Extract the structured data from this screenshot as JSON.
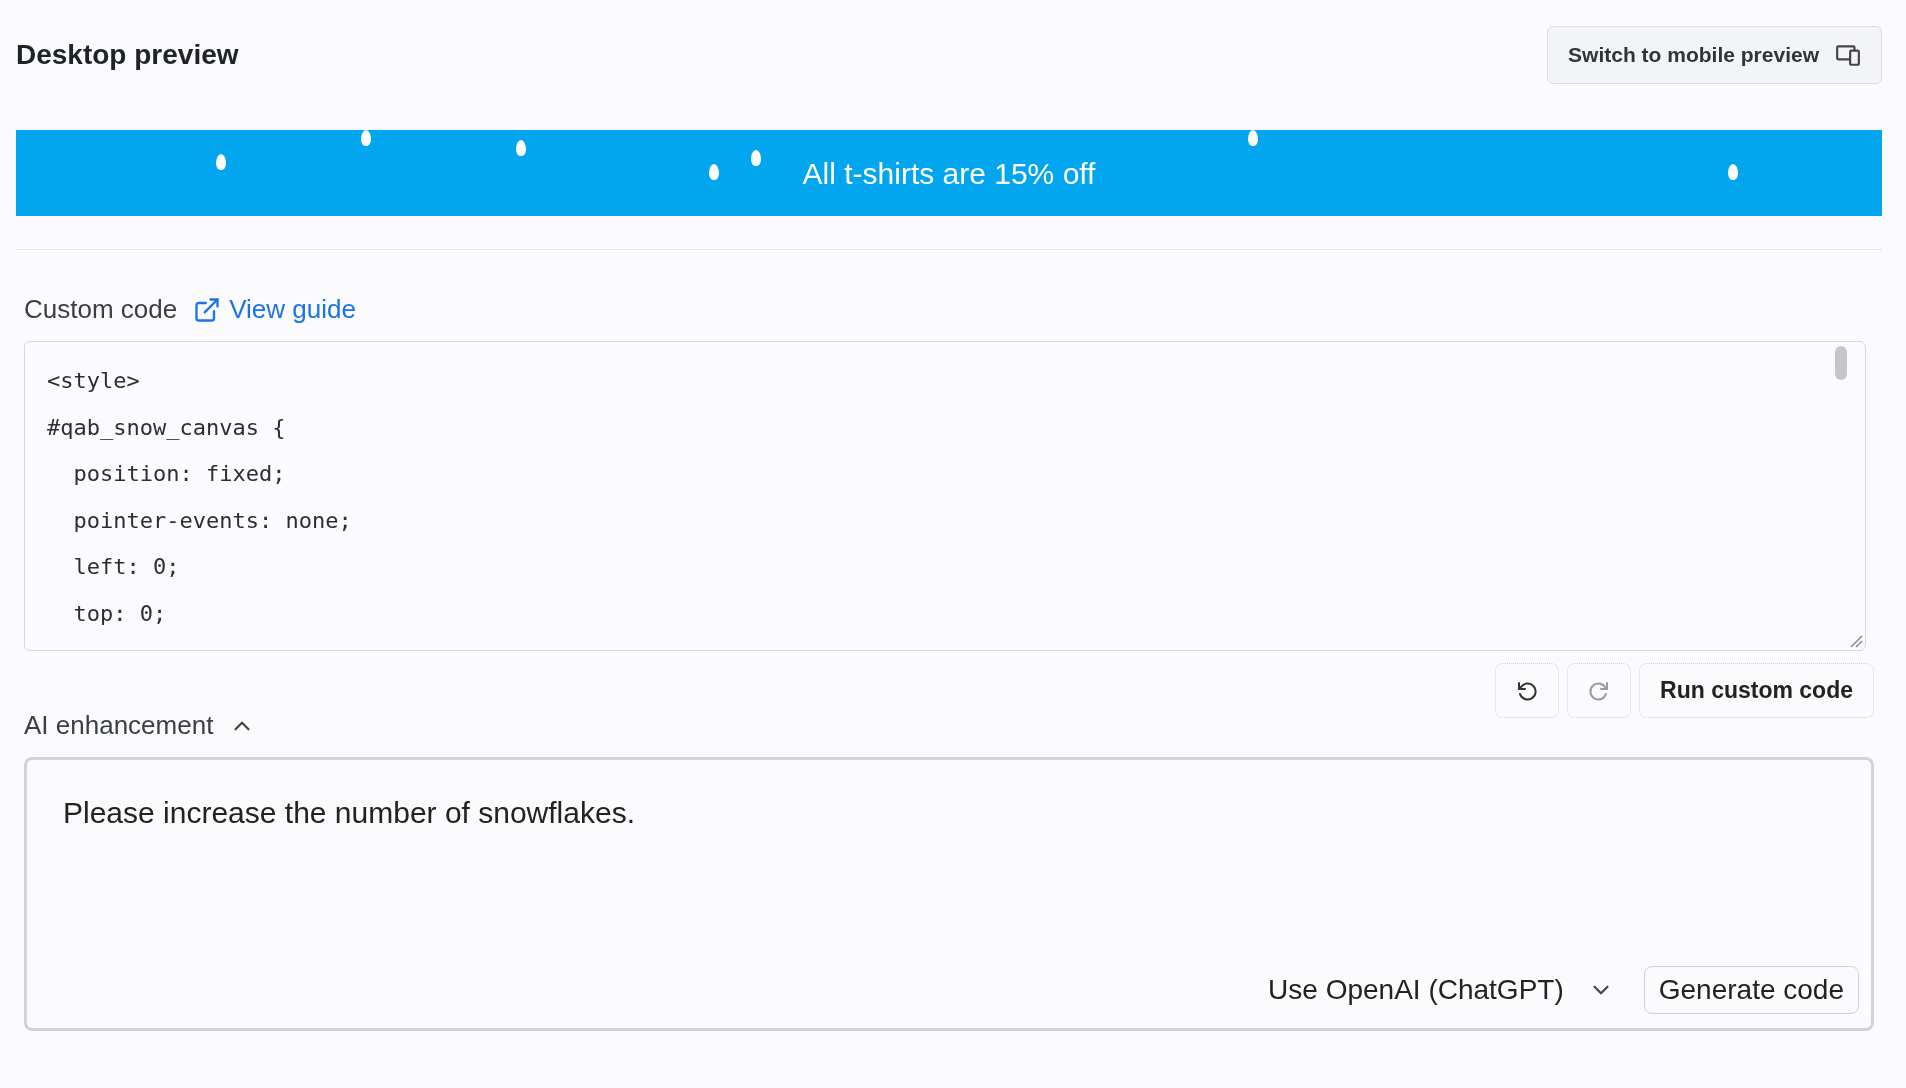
{
  "header": {
    "title": "Desktop preview",
    "switch_button": "Switch to mobile preview"
  },
  "banner": {
    "text": "All t-shirts are 15% off"
  },
  "custom_code": {
    "label": "Custom code",
    "link": "View guide",
    "lines": [
      "<style>",
      "#qab_snow_canvas {",
      "  position: fixed;",
      "  pointer-events: none;",
      "  left: 0;",
      "  top: 0;"
    ]
  },
  "history_buttons": [
    {
      "kind": "undo",
      "disabled": false
    },
    {
      "kind": "redo",
      "disabled": true
    }
  ],
  "run_button": "Run custom code",
  "ai": {
    "label": "AI enhancement",
    "expanded": true,
    "value": "Please increase the number of snowflakes.",
    "model": "Use OpenAI (ChatGPT)",
    "generate_button": "Generate code"
  }
}
